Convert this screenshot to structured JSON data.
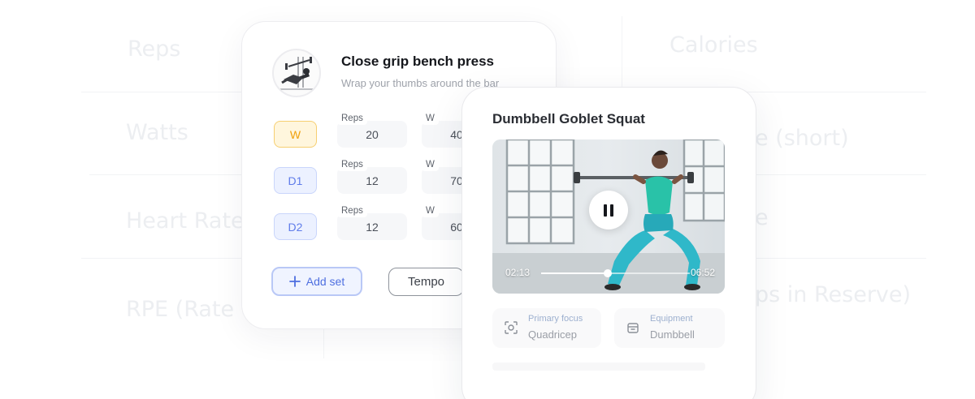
{
  "background": {
    "left_labels": [
      "Reps",
      "Watts",
      "Heart Rates",
      "RPE (Rate o"
    ],
    "right_labels": [
      "Calories",
      "e (short)",
      "e",
      "ps in Reserve)"
    ]
  },
  "exercise_card": {
    "title": "Close grip bench press",
    "subtitle": "Wrap your thumbs around the bar",
    "sets": [
      {
        "tag": "W",
        "reps_label": "Reps",
        "reps": "20",
        "weight_label": "W",
        "weight": "40"
      },
      {
        "tag": "D1",
        "reps_label": "Reps",
        "reps": "12",
        "weight_label": "W",
        "weight": "70"
      },
      {
        "tag": "D2",
        "reps_label": "Reps",
        "reps": "12",
        "weight_label": "W",
        "weight": "60"
      }
    ],
    "add_set_label": "Add set",
    "tempo_label": "Tempo"
  },
  "video_card": {
    "title": "Dumbbell Goblet Squat",
    "current_time": "02:13",
    "total_time": "06:52",
    "progress": 0.45,
    "primary_focus_label": "Primary focus",
    "primary_focus_value": "Quadricep",
    "equipment_label": "Equipment",
    "equipment_value": "Dumbbell"
  },
  "icons": [
    "add-icon",
    "pause-icon",
    "focus-icon",
    "equipment-icon",
    "bench-press-illustration-icon"
  ],
  "colors": {
    "warmup_accent": "#f0a10b",
    "drop_accent": "#5f7cea",
    "add_set_accent": "#4e6fe0",
    "leggings": "#2fb8c9"
  }
}
